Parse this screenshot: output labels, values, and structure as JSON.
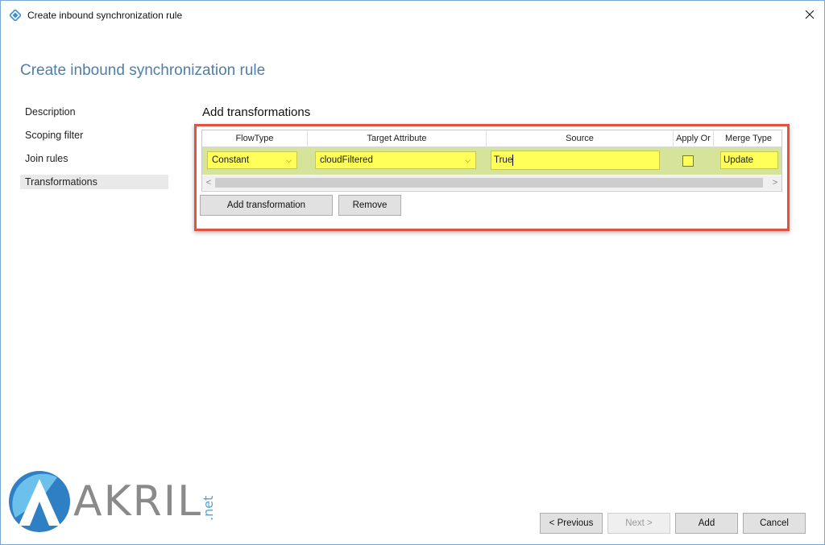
{
  "window": {
    "title": "Create inbound synchronization rule",
    "close_glyph": "✕"
  },
  "page": {
    "heading": "Create inbound synchronization rule",
    "section_title": "Add transformations"
  },
  "nav": {
    "items": [
      {
        "label": "Description",
        "active": false
      },
      {
        "label": "Scoping filter",
        "active": false
      },
      {
        "label": "Join rules",
        "active": false
      },
      {
        "label": "Transformations",
        "active": true
      }
    ]
  },
  "grid": {
    "headers": [
      "FlowType",
      "Target Attribute",
      "Source",
      "Apply Or",
      "Merge Type"
    ],
    "rows": [
      {
        "flow_type": "Constant",
        "target_attribute": "cloudFiltered",
        "source": "True",
        "apply_once": false,
        "merge_type": "Update"
      }
    ],
    "scroll_left": "<",
    "scroll_right": ">"
  },
  "grid_buttons": {
    "add": "Add transformation",
    "remove": "Remove"
  },
  "footer": {
    "previous": "< Previous",
    "next": "Next >",
    "add": "Add",
    "cancel": "Cancel"
  },
  "logo": {
    "text": "AKRIL",
    "suffix": ".net"
  },
  "colors": {
    "accent_heading": "#4f7ea8",
    "highlight_frame": "#e0543f",
    "cell_highlight": "#ffff5a",
    "row_selected": "#d6e39a",
    "logo_blue": "#4aa3e0"
  }
}
